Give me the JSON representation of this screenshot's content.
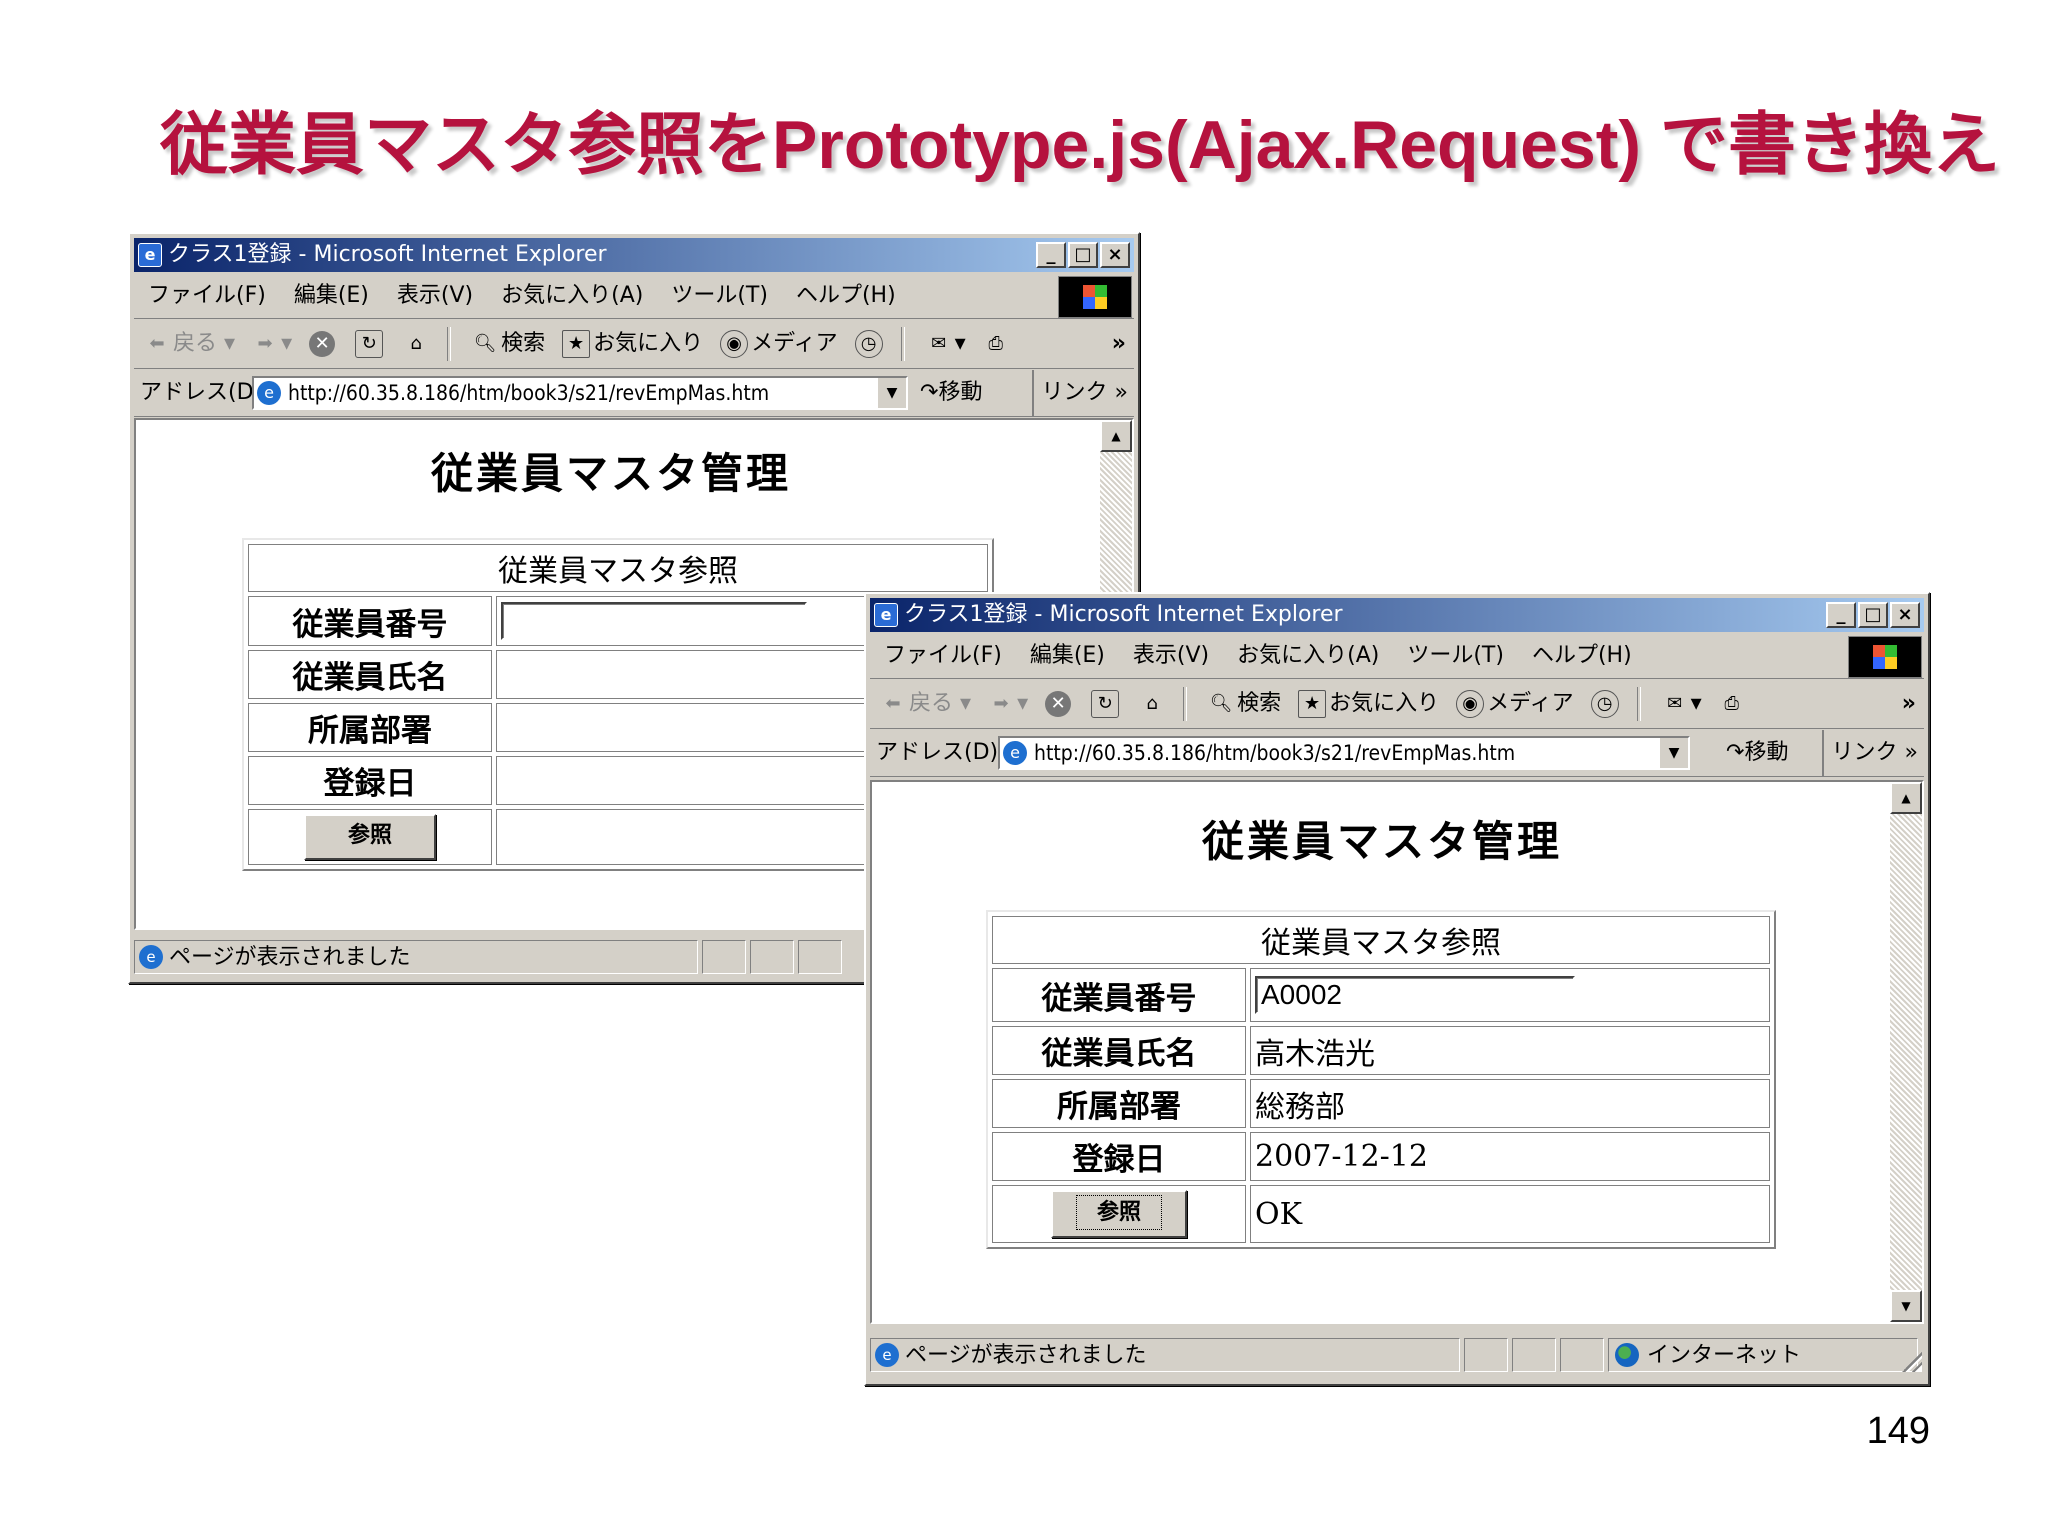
{
  "slide": {
    "title": "従業員マスタ参照をPrototype.js(Ajax.Request) で書き換え",
    "page_number": "149"
  },
  "browser": {
    "title": "クラス1登録 - Microsoft Internet Explorer",
    "menu": [
      "ファイル(F)",
      "編集(E)",
      "表示(V)",
      "お気に入り(A)",
      "ツール(T)",
      "ヘルプ(H)"
    ],
    "toolbar": {
      "back": "戻る",
      "search": "検索",
      "favorites": "お気に入り",
      "media": "メディア",
      "more": "»"
    },
    "address_label": "アドレス(D)",
    "address_url": "http://60.35.8.186/htm/book3/s21/revEmpMas.htm",
    "go": "移動",
    "links": "リンク »",
    "status": "ページが表示されました",
    "zone": "インターネット",
    "window_buttons": [
      "_",
      "□",
      "×"
    ]
  },
  "page": {
    "heading": "従業員マスタ管理",
    "table_header": "従業員マスタ参照",
    "labels": {
      "emp_no": "従業員番号",
      "emp_name": "従業員氏名",
      "dept": "所属部署",
      "reg_date": "登録日"
    },
    "button": "参照"
  },
  "before": {
    "emp_no": "",
    "emp_name": "",
    "dept": "",
    "reg_date": "",
    "result": ""
  },
  "after": {
    "emp_no": "A0002",
    "emp_name": "高木浩光",
    "dept": "総務部",
    "reg_date": "2007-12-12",
    "result": "OK"
  },
  "colors": {
    "title": "#b5123e",
    "titlebar_start": "#0a246a",
    "titlebar_end": "#a6caf0",
    "chrome": "#d4d0c8"
  }
}
